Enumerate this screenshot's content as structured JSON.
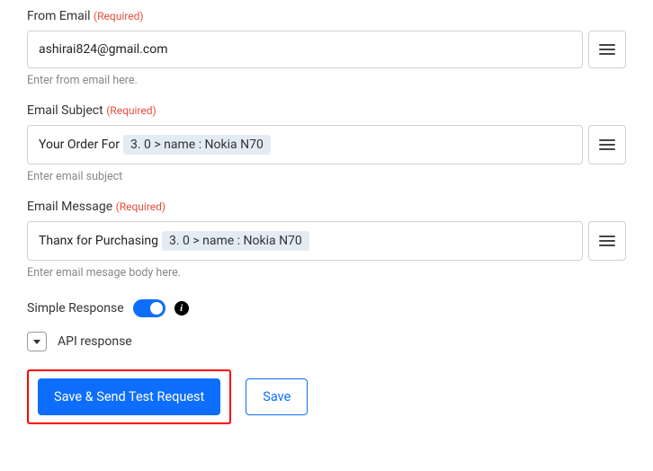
{
  "fields": {
    "fromEmail": {
      "label": "From Email",
      "required": "(Required)",
      "value": "ashirai824@gmail.com",
      "helper": "Enter from email here."
    },
    "emailSubject": {
      "label": "Email Subject",
      "required": "(Required)",
      "prefix": "Your Order For",
      "token": "3. 0 > name : Nokia N70",
      "helper": "Enter email subject"
    },
    "emailMessage": {
      "label": "Email Message",
      "required": "(Required)",
      "prefix": "Thanx for Purchasing",
      "token": "3. 0 > name : Nokia N70",
      "helper": "Enter email mesage body here."
    }
  },
  "simpleResponse": {
    "label": "Simple Response",
    "infoTooltip": "i"
  },
  "apiResponse": {
    "label": "API response"
  },
  "buttons": {
    "primary": "Save & Send Test Request",
    "secondary": "Save"
  }
}
